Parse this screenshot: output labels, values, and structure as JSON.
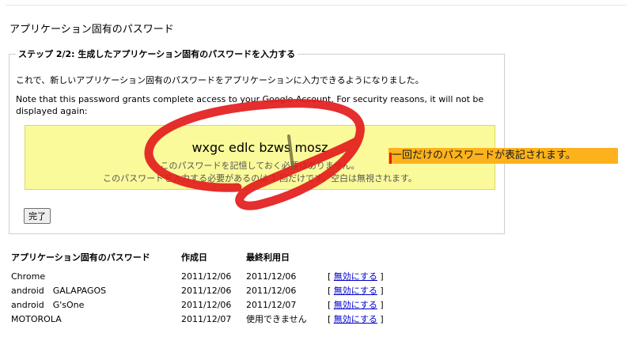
{
  "page": {
    "title": "アプリケーション固有のパスワード"
  },
  "step": {
    "legend": "ステップ 2/2: 生成したアプリケーション固有のパスワードを入力する",
    "instruction": "これで、新しいアプリケーション固有のパスワードをアプリケーションに入力できるようになりました。",
    "notice": "Note that this password grants complete access to your Google Account. For security reasons, it will not be displayed again:",
    "password": "wxgc edlc bzws mosz",
    "note_memorize": "このパスワードを記憶しておく必要はありません。",
    "note_enter_once": "このパスワードを入力する必要があるのは 1 回だけです。空白は無視されます。",
    "done_label": "完了"
  },
  "annotation": {
    "text": "一回だけのパスワードが表記されます。",
    "color": "#fcb21c",
    "scribble_color": "#e31c1c"
  },
  "table": {
    "headers": [
      "アプリケーション固有のパスワード",
      "作成日",
      "最終利用日"
    ],
    "rows": [
      {
        "name": "Chrome",
        "created": "2011/12/06",
        "last_used": "2011/12/06",
        "action": "無効にする"
      },
      {
        "name": "android　GALAPAGOS",
        "created": "2011/12/06",
        "last_used": "2011/12/06",
        "action": "無効にする"
      },
      {
        "name": "android　G'sOne",
        "created": "2011/12/06",
        "last_used": "2011/12/07",
        "action": "無効にする"
      },
      {
        "name": "MOTOROLA",
        "created": "2011/12/07",
        "last_used": "使用できません",
        "action": "無効にする"
      }
    ]
  }
}
